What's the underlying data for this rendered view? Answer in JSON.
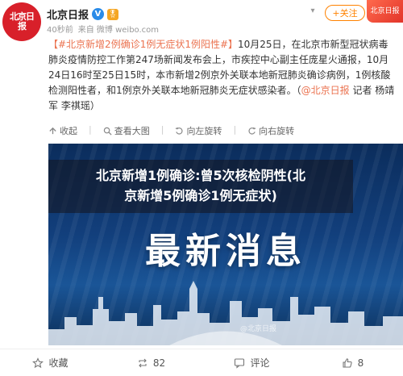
{
  "account": {
    "avatar_text": "北京日报",
    "name": "北京日报",
    "verified_icon": "V",
    "medal_icon": "🎖",
    "time": "40秒前",
    "source": "来自 微博 weibo.com"
  },
  "header": {
    "follow_label": "+关注",
    "ad_label": "北京日报"
  },
  "post": {
    "topic": "【#北京新增2例确诊1例无症状1例阳性#】",
    "text": "10月25日，在北京市新型冠状病毒肺炎疫情防控工作第247场新闻发布会上，市疾控中心副主任庞星火通报，10月24日16时至25日15时，本市新增2例京外关联本地新冠肺炎确诊病例，1例核酸检测阳性者，和1例京外关联本地新冠肺炎无症状感染者。（",
    "mention": "@北京日报",
    "tail": " 记者 杨靖军 李祺瑶）"
  },
  "actions": {
    "collapse": "收起",
    "view_large": "查看大图",
    "rotate_left": "向左旋转",
    "rotate_right": "向右旋转"
  },
  "image": {
    "headline": "最新消息",
    "watermark": "@北京日报",
    "overlay_line1": "北京新增1例确诊:曾5次核检阴性(北",
    "overlay_line2": "京新增5例确诊1例无症状)"
  },
  "footer": {
    "favorite": "收藏",
    "repost": "82",
    "comment": "评论",
    "like": "8"
  },
  "colors": {
    "brand_red": "#d8202a",
    "accent_orange": "#ff8200",
    "link": "#eb7350"
  }
}
